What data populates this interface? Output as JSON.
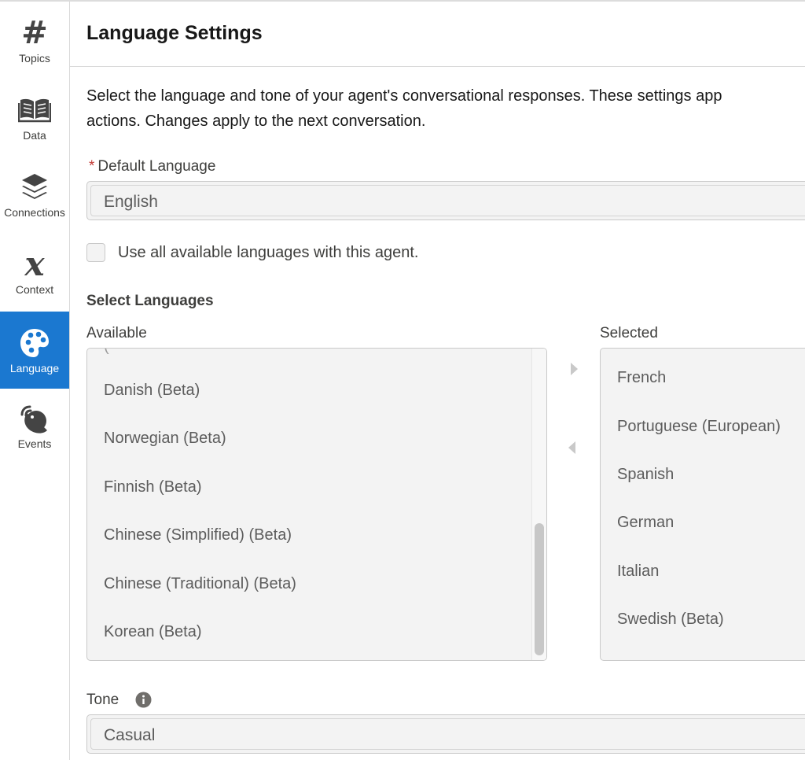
{
  "sidebar": {
    "items": [
      {
        "label": "Topics",
        "icon": "hash-icon"
      },
      {
        "label": "Data",
        "icon": "book-icon"
      },
      {
        "label": "Connections",
        "icon": "layers-icon"
      },
      {
        "label": "Context",
        "icon": "variable-x-icon"
      },
      {
        "label": "Language",
        "icon": "palette-icon",
        "active": true
      },
      {
        "label": "Events",
        "icon": "satellite-icon"
      }
    ],
    "active_color": "#1b78d0"
  },
  "header": {
    "title": "Language Settings"
  },
  "main": {
    "description_line1": "Select the language and tone of your agent's conversational responses. These settings app",
    "description_line2": "actions. Changes apply to the next conversation.",
    "default_language": {
      "required_mark": "*",
      "label": "Default Language",
      "value": "English"
    },
    "use_all": {
      "label": "Use all available languages with this agent.",
      "checked": false
    },
    "select_languages": {
      "heading": "Select Languages",
      "available_label": "Available",
      "selected_label": "Selected",
      "available": [
        "Danish (Beta)",
        "Norwegian (Beta)",
        "Finnish (Beta)",
        "Chinese (Simplified) (Beta)",
        "Chinese (Traditional) (Beta)",
        "Korean (Beta)"
      ],
      "selected": [
        "French",
        "Portuguese (European)",
        "Spanish",
        "German",
        "Italian",
        "Swedish (Beta)"
      ]
    },
    "tone": {
      "label": "Tone",
      "value": "Casual"
    }
  }
}
